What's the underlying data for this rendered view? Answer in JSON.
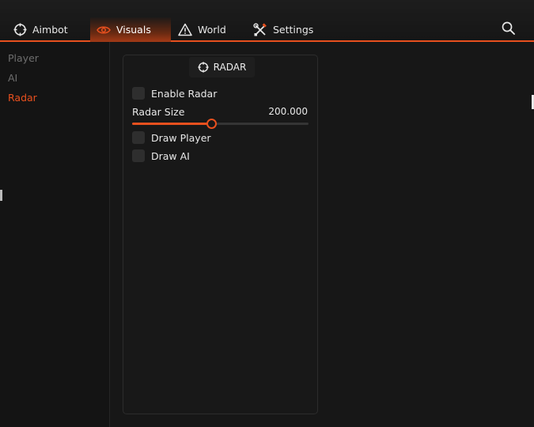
{
  "tabs": [
    {
      "label": "Aimbot",
      "icon": "crosshair-icon",
      "active": false
    },
    {
      "label": "Visuals",
      "icon": "eye-icon",
      "active": true
    },
    {
      "label": "World",
      "icon": "warning-triangle-icon",
      "active": false
    },
    {
      "label": "Settings",
      "icon": "tools-icon",
      "active": false
    }
  ],
  "search": {
    "icon": "search-icon"
  },
  "sidebar": {
    "items": [
      {
        "label": "Player",
        "active": false
      },
      {
        "label": "AI",
        "active": false
      },
      {
        "label": "Radar",
        "active": true
      }
    ]
  },
  "panel": {
    "title": "RADAR",
    "title_icon": "crosshair-icon",
    "enable_radar": {
      "label": "Enable Radar",
      "checked": false
    },
    "radar_size": {
      "label": "Radar Size",
      "value": "200.000",
      "fraction": 0.45
    },
    "draw_player": {
      "label": "Draw Player",
      "checked": false
    },
    "draw_ai": {
      "label": "Draw AI",
      "checked": false
    }
  },
  "colors": {
    "accent": "#e8501e",
    "background": "#171717",
    "panel": "#181818",
    "checkbox": "#2e2e2e",
    "inactive_text": "#6e6e6e"
  }
}
